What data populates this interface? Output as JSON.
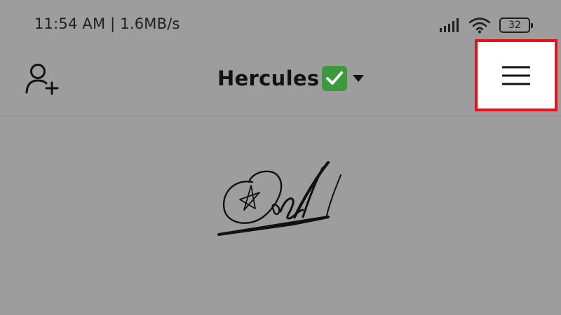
{
  "status_bar": {
    "time_text": "11:54 AM | 1.6MB/s",
    "battery_level": "32",
    "icons": [
      "signal-icon",
      "wifi-icon",
      "battery-icon"
    ]
  },
  "header": {
    "profile_name": "Hercules",
    "verified_badge_icon": "check-mark-button-icon",
    "add_user_icon": "add-person-icon",
    "menu_icon": "hamburger-menu-icon"
  },
  "content": {
    "logo_icon": "signature-logo"
  },
  "colors": {
    "background": "#9d9d9d",
    "highlight_box": "#e3121b",
    "verified_badge": "#3c9a3c",
    "text": "#121212"
  }
}
